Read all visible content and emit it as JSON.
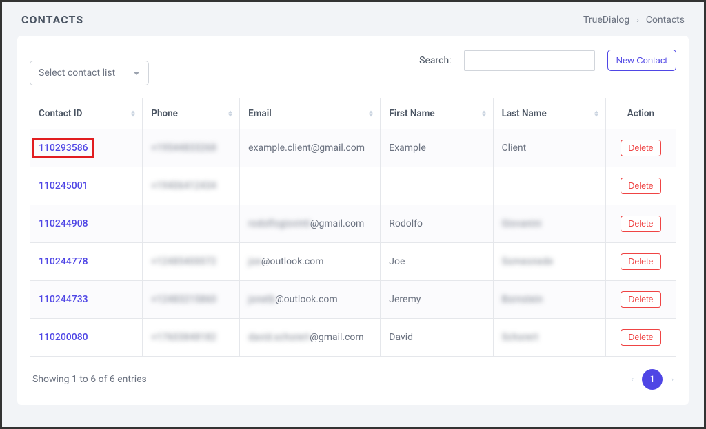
{
  "header": {
    "title": "CONTACTS",
    "breadcrumb_root": "TrueDialog",
    "breadcrumb_current": "Contacts"
  },
  "toolbar": {
    "select_placeholder": "Select contact list",
    "search_label": "Search:",
    "new_contact_label": "New Contact"
  },
  "table": {
    "headers": {
      "id": "Contact ID",
      "phone": "Phone",
      "email": "Email",
      "first_name": "First Name",
      "last_name": "Last Name",
      "action": "Action"
    },
    "delete_label": "Delete",
    "rows": [
      {
        "id": "110293586",
        "highlighted": true,
        "phone": {
          "blurred": "+19544833268"
        },
        "email": {
          "blurred": "",
          "visible": "example.client@gmail.com"
        },
        "first_name": {
          "visible": "Example"
        },
        "last_name": {
          "visible": "Client"
        }
      },
      {
        "id": "110245001",
        "phone": {
          "blurred": "+19406412434"
        },
        "email": {
          "blurred": "",
          "visible": ""
        },
        "first_name": {
          "visible": ""
        },
        "last_name": {
          "visible": ""
        }
      },
      {
        "id": "110244908",
        "phone": {
          "blurred": ""
        },
        "email": {
          "blurred": "rodolfogiovinti",
          "visible": "@gmail.com"
        },
        "first_name": {
          "visible": "Rodolfo"
        },
        "last_name": {
          "blurred": "Giovanini"
        }
      },
      {
        "id": "110244778",
        "phone": {
          "blurred": "+12485400072"
        },
        "email": {
          "blurred": "joe",
          "visible": "@outlook.com"
        },
        "first_name": {
          "visible": "Joe"
        },
        "last_name": {
          "blurred": "Someonede"
        }
      },
      {
        "id": "110244733",
        "phone": {
          "blurred": "+12483215860"
        },
        "email": {
          "blurred": "jonetb",
          "visible": "@outlook.com"
        },
        "first_name": {
          "visible": "Jeremy"
        },
        "last_name": {
          "blurred": "Bornstein"
        }
      },
      {
        "id": "110200080",
        "phone": {
          "blurred": "+17603848182"
        },
        "email": {
          "blurred": "david.schorert",
          "visible": "@gmail.com"
        },
        "first_name": {
          "visible": "David"
        },
        "last_name": {
          "blurred": "Schorert"
        }
      }
    ]
  },
  "footer": {
    "entries_text": "Showing 1 to 6 of 6 entries",
    "page_number": "1"
  }
}
